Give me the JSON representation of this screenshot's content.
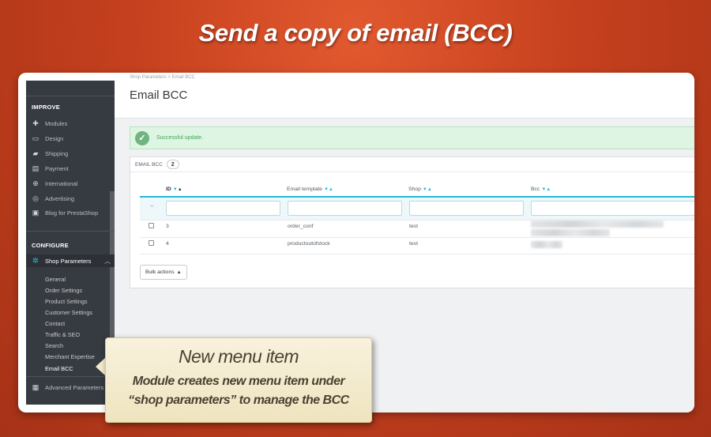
{
  "headline": "Send a copy of email (BCC)",
  "sidebar": {
    "improve_label": "IMPROVE",
    "improve_items": [
      {
        "label": "Modules",
        "icon": "puzzle-icon"
      },
      {
        "label": "Design",
        "icon": "monitor-icon"
      },
      {
        "label": "Shipping",
        "icon": "truck-icon"
      },
      {
        "label": "Payment",
        "icon": "credit-card-icon"
      },
      {
        "label": "International",
        "icon": "globe-icon"
      },
      {
        "label": "Advertising",
        "icon": "bullseye-icon"
      },
      {
        "label": "Blog for PrestaShop",
        "icon": "blog-icon"
      }
    ],
    "configure_label": "CONFIGURE",
    "active_item": {
      "label": "Shop Parameters",
      "icon": "gear-icon"
    },
    "sub_items": [
      "General",
      "Order Settings",
      "Product Settings",
      "Customer Settings",
      "Contact",
      "Traffic & SEO",
      "Search",
      "Merchant Expertise",
      "Email BCC"
    ],
    "advanced_item": {
      "label": "Advanced Parameters",
      "icon": "settings-box-icon"
    }
  },
  "header": {
    "breadcrumb": "Shop Parameters  >  Email BCC",
    "title": "Email BCC"
  },
  "alert": {
    "message": "Successful update.",
    "color": "#70b580"
  },
  "panel": {
    "title": "EMAIL BCC",
    "count": "2",
    "columns": [
      "ID",
      "Email template",
      "Shop",
      "Bcc"
    ],
    "filter_placeholder": "--",
    "rows": [
      {
        "id": "3",
        "template": "order_conf",
        "shop": "test"
      },
      {
        "id": "4",
        "template": "productoutofstock",
        "shop": "test"
      }
    ],
    "bulk_label": "Bulk actions"
  },
  "callout": {
    "title": "New menu item",
    "line1": "Module creates new menu item under",
    "line2": "“shop parameters” to manage the BCC"
  },
  "colors": {
    "accent": "#25b9d7",
    "sidebar_bg": "#363a41",
    "background": "#c5401e"
  }
}
